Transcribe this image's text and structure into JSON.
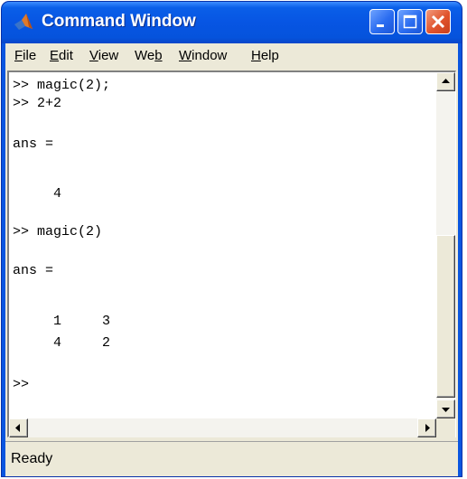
{
  "window": {
    "title": "Command Window"
  },
  "menu": [
    "File",
    "Edit",
    "View",
    "Web",
    "Window",
    "Help"
  ],
  "console": {
    "lines": [
      ">> magic(2);",
      ">> 2+2",
      "",
      "ans =",
      "",
      "     4",
      "",
      ">> magic(2)",
      "",
      "ans =",
      "",
      "     1     3",
      "     4     2",
      "",
      ">>"
    ]
  },
  "status": {
    "text": "Ready"
  },
  "icons": {
    "app": "matlab-logo-icon",
    "minimize": "minimize-icon",
    "maximize": "maximize-icon",
    "close": "close-icon",
    "scroll_up": "arrow-up-icon",
    "scroll_down": "arrow-down-icon",
    "scroll_left": "arrow-left-icon",
    "scroll_right": "arrow-right-icon"
  },
  "colors": {
    "titlebar": "#0755e3",
    "close_button": "#e0532c",
    "chrome": "#ece9d8"
  }
}
